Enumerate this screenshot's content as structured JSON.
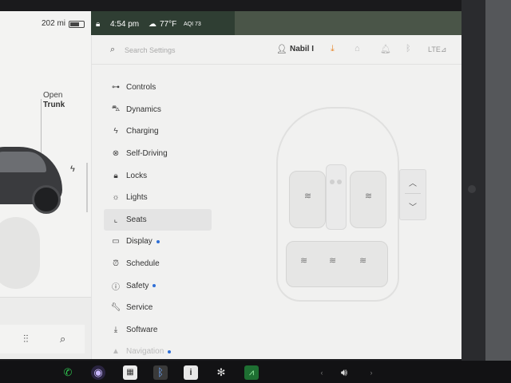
{
  "status_bar": {
    "range": "202 mi",
    "time": "4:54 pm",
    "temperature": "77°F",
    "aqi": "AQI 73"
  },
  "car_panel": {
    "trunk_top": "Open",
    "trunk_bottom": "Trunk"
  },
  "header": {
    "search_placeholder": "Search Settings",
    "user_name": "Nabil I",
    "signal_label": "LTE"
  },
  "menu": {
    "items": [
      {
        "label": "Controls"
      },
      {
        "label": "Dynamics"
      },
      {
        "label": "Charging"
      },
      {
        "label": "Self-Driving"
      },
      {
        "label": "Locks"
      },
      {
        "label": "Lights"
      },
      {
        "label": "Seats"
      },
      {
        "label": "Display"
      },
      {
        "label": "Schedule"
      },
      {
        "label": "Safety"
      },
      {
        "label": "Service"
      },
      {
        "label": "Software"
      },
      {
        "label": "Navigation"
      }
    ],
    "active": "Seats"
  },
  "colors": {
    "accent_orange": "#e8862a",
    "notification_blue": "#2f6fd6",
    "phone_green": "#2fbf4e"
  }
}
